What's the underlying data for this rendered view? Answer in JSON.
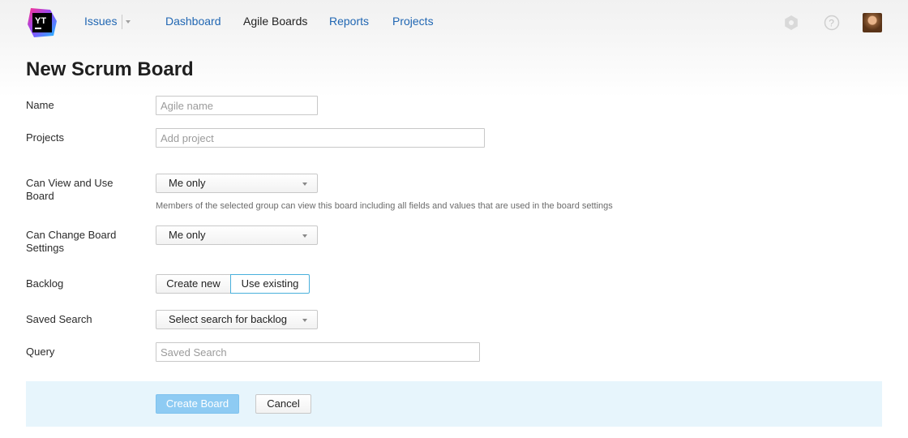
{
  "logo": {
    "text": "YT"
  },
  "nav": {
    "issues": "Issues",
    "dashboard": "Dashboard",
    "agile_boards": "Agile Boards",
    "reports": "Reports",
    "projects": "Projects"
  },
  "header_icons": [
    "gear-icon",
    "help-icon",
    "user-avatar"
  ],
  "page_title": "New Scrum Board",
  "form": {
    "name": {
      "label": "Name",
      "placeholder": "Agile name"
    },
    "projects": {
      "label": "Projects",
      "placeholder": "Add project"
    },
    "can_view": {
      "label": "Can View and Use Board",
      "value": "Me only",
      "hint": "Members of the selected group can view this board including all fields and values that are used in the board settings"
    },
    "can_change": {
      "label": "Can Change Board Settings",
      "value": "Me only"
    },
    "backlog": {
      "label": "Backlog",
      "options": [
        "Create new",
        "Use existing"
      ],
      "selected": "Use existing"
    },
    "saved_search": {
      "label": "Saved Search",
      "value": "Select search for backlog"
    },
    "query": {
      "label": "Query",
      "placeholder": "Saved Search"
    }
  },
  "actions": {
    "create": "Create Board",
    "cancel": "Cancel"
  },
  "colors": {
    "accent": "#2167b3",
    "footer_bg": "#e7f5fc",
    "primary_button": "#8ecbf3",
    "selected_border": "#4ab0dc"
  }
}
